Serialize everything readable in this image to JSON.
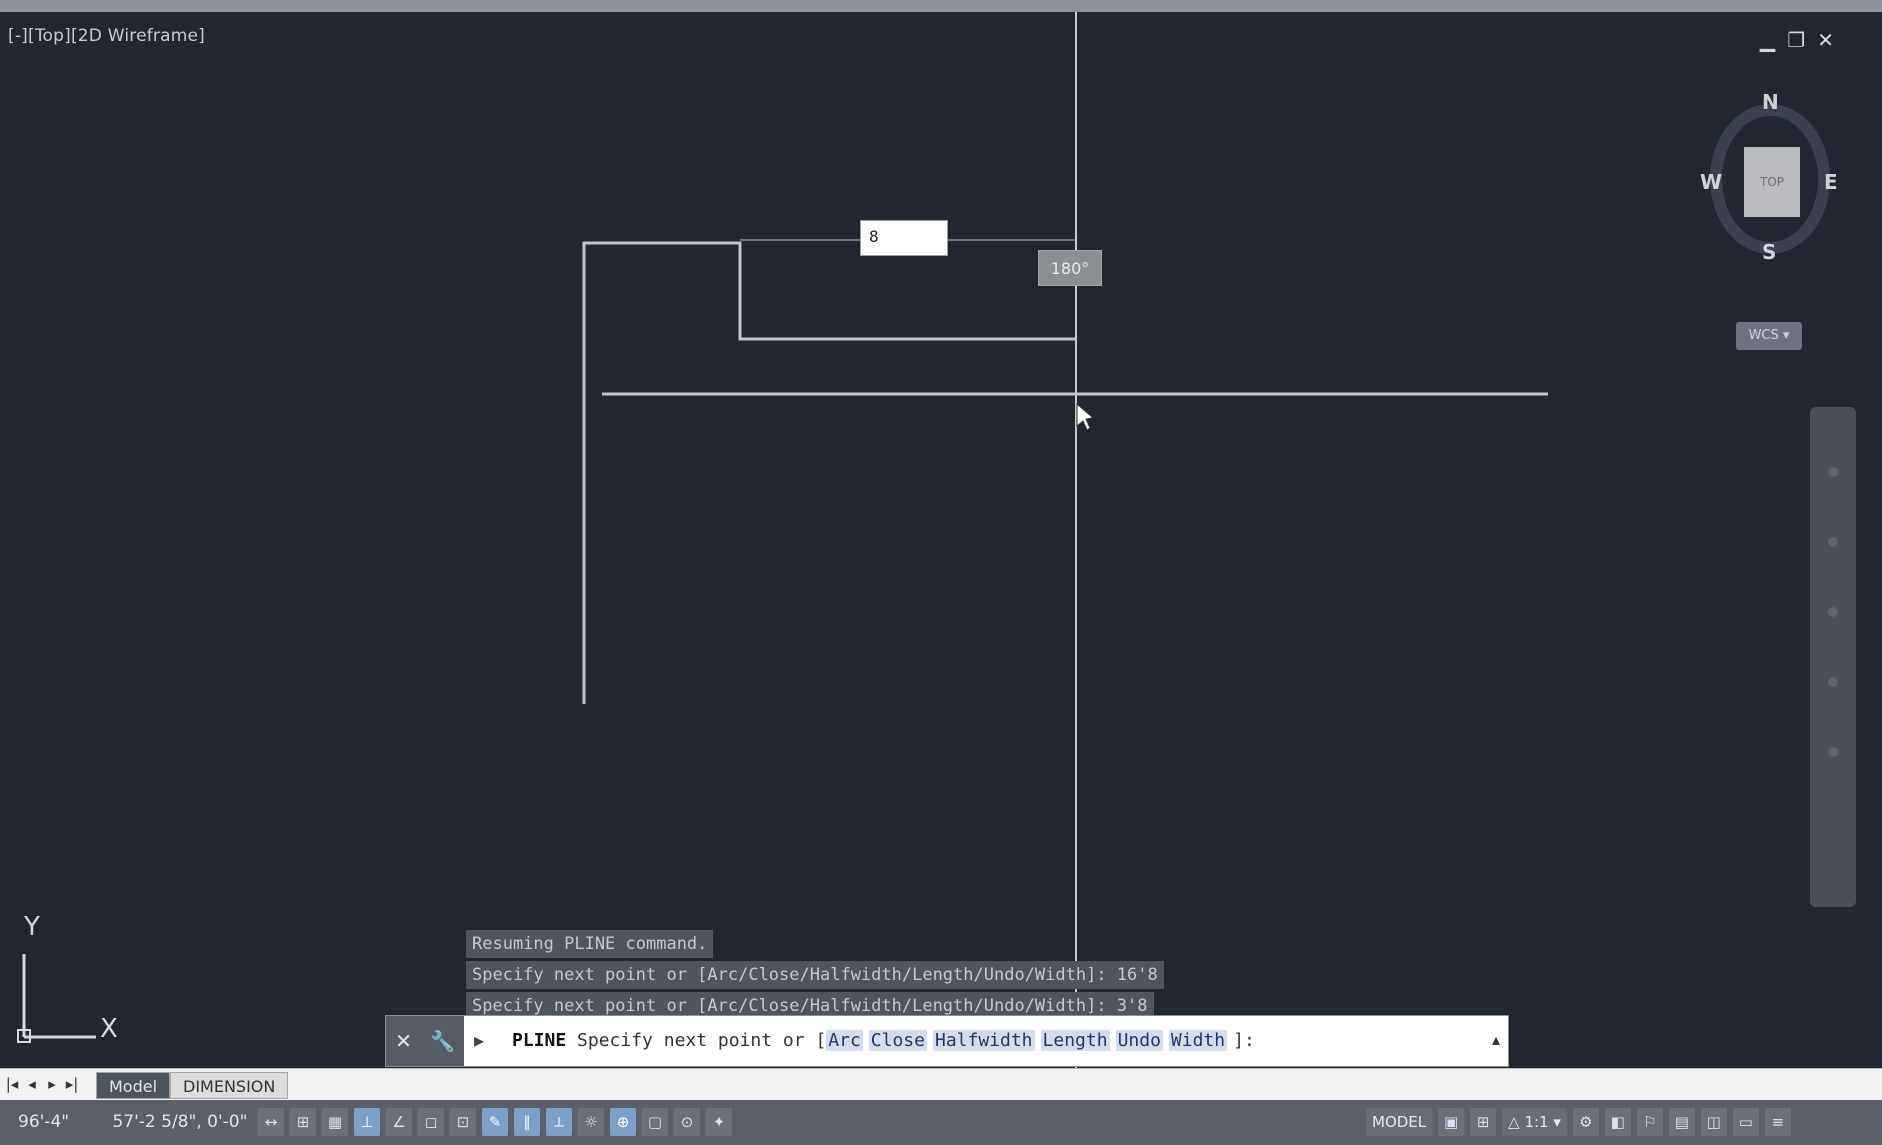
{
  "viewport": {
    "label": "[-][Top][2D Wireframe]",
    "window_controls": {
      "minimize": "▁",
      "restore": "❐",
      "close": "✕"
    }
  },
  "dynamic_input": {
    "value": "8",
    "angle": "180°"
  },
  "viewcube": {
    "north": "N",
    "south": "S",
    "east": "E",
    "west": "W",
    "face": "TOP",
    "wcs": "WCS ▾"
  },
  "ucs": {
    "x": "X",
    "y": "Y"
  },
  "command_history": [
    "Resuming PLINE command.",
    "Specify next point or [Arc/Close/Halfwidth/Length/Undo/Width]: 16'8",
    "Specify next point or [Arc/Close/Halfwidth/Length/Undo/Width]: 3'8"
  ],
  "command_line": {
    "close_icon": "✕",
    "wrench_icon": "🔧",
    "prompt_icon": "▸",
    "command": "PLINE",
    "prompt": "Specify next point or [",
    "options": [
      "Arc",
      "Close",
      "Halfwidth",
      "Length",
      "Undo",
      "Width"
    ],
    "suffix": "]:",
    "scroll_glyph": "▴"
  },
  "layout_tabs": {
    "arrows": [
      "|◂",
      "◂",
      "▸",
      "▸|"
    ],
    "tabs": [
      "Model",
      "DIMENSION"
    ]
  },
  "status_bar": {
    "coords": [
      "96'-4\"",
      "57'-2 5/8\", 0'-0\""
    ],
    "icons": [
      "↔",
      "⊞",
      "▦",
      "⊥",
      "∠",
      "◻",
      "⊡",
      "✎",
      "∥",
      "⟂",
      "☼",
      "⊕",
      "▢",
      "⊙",
      "✦"
    ],
    "model": "MODEL",
    "right_icons": [
      "▣",
      "⊞",
      "△ 1:1 ▾",
      "⚙",
      "◧",
      "⚐",
      "▤",
      "◫",
      "▭",
      "≡"
    ]
  },
  "colors": {
    "canvas": "#212630",
    "lines": "#c2c5ca",
    "command_options": "#d6dcf0",
    "status_bar": "#5b6068"
  }
}
